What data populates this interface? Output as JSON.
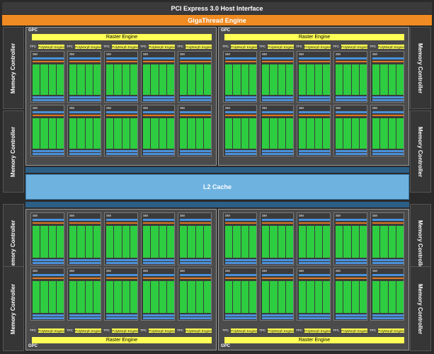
{
  "host_interface": "PCI Express 3.0 Host Interface",
  "gigathread": "GigaThread Engine",
  "memory_controller": "Memory Controller",
  "gpc_label": "GPC",
  "raster_engine": "Raster Engine",
  "tpc_label": "TPC",
  "polymorph_engine": "PolyMorph Engine",
  "sm_label": "SM",
  "l2_cache": "L2 Cache",
  "colors": {
    "host_bar": "#3a3a3a",
    "gigathread": "#f08a22",
    "raster": "#ffff55",
    "core": "#2ecc40",
    "register": "#4a90d9",
    "l2": "#6eb2e0",
    "orange_unit": "#e07820"
  },
  "gpcs": [
    "top-left",
    "top-right",
    "bottom-left",
    "bottom-right"
  ],
  "tpcs_per_gpc": 5
}
